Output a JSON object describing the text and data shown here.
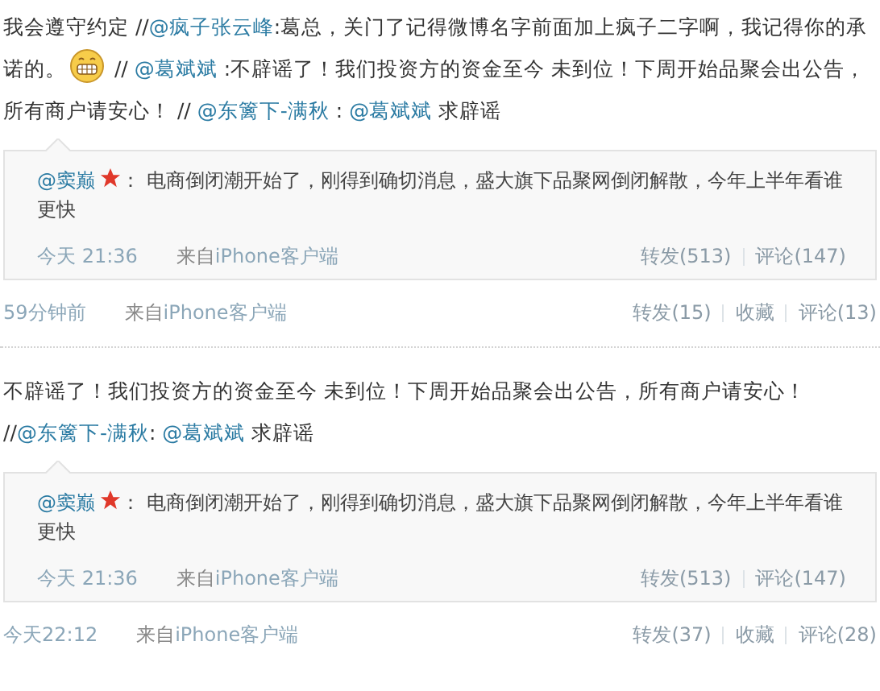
{
  "posts": [
    {
      "text": [
        {
          "kind": "text",
          "text": "我会遵守约定 //"
        },
        {
          "kind": "mention",
          "text": "@疯子张云峰"
        },
        {
          "kind": "text",
          "text": ":葛总，关门了记得微博名字前面加上疯子二字啊，我记得你的承诺的。"
        },
        {
          "kind": "emoji"
        },
        {
          "kind": "text",
          "text": " // "
        },
        {
          "kind": "mention",
          "text": "@葛斌斌"
        },
        {
          "kind": "text",
          "text": " :不辟谣了！我们投资方的资金至今 未到位！下周开始品聚会出公告，所有商户请安心！ // "
        },
        {
          "kind": "mention",
          "text": "@东篱下-满秋"
        },
        {
          "kind": "text",
          "text": " : "
        },
        {
          "kind": "mention",
          "text": "@葛斌斌"
        },
        {
          "kind": "text",
          "text": " 求辟谣"
        }
      ],
      "quote": {
        "author": "@窦巅",
        "verified": true,
        "colon": "：",
        "text": "电商倒闭潮开始了，刚得到确切消息，盛大旗下品聚网倒闭解散，今年上半年看谁更快",
        "time": "今天 21:36",
        "source_prefix": "来自",
        "source": "iPhone客户端",
        "actions": [
          "转发(513)",
          "评论(147)"
        ]
      },
      "time": "59分钟前",
      "source_prefix": "来自",
      "source": "iPhone客户端",
      "actions": [
        "转发(15)",
        "收藏",
        "评论(13)"
      ]
    },
    {
      "text": [
        {
          "kind": "text",
          "text": "不辟谣了！我们投资方的资金至今 未到位！下周开始品聚会出公告，所有商户请安心！ //"
        },
        {
          "kind": "mention",
          "text": "@东篱下-满秋"
        },
        {
          "kind": "text",
          "text": ": "
        },
        {
          "kind": "mention",
          "text": "@葛斌斌"
        },
        {
          "kind": "text",
          "text": " 求辟谣"
        }
      ],
      "quote": {
        "author": "@窦巅",
        "verified": true,
        "colon": "：",
        "text": "电商倒闭潮开始了，刚得到确切消息，盛大旗下品聚网倒闭解散，今年上半年看谁更快",
        "time": "今天 21:36",
        "source_prefix": "来自",
        "source": "iPhone客户端",
        "actions": [
          "转发(513)",
          "评论(147)"
        ]
      },
      "time": "今天22:12",
      "source_prefix": "来自",
      "source": "iPhone客户端",
      "actions": [
        "转发(37)",
        "收藏",
        "评论(28)"
      ]
    }
  ]
}
